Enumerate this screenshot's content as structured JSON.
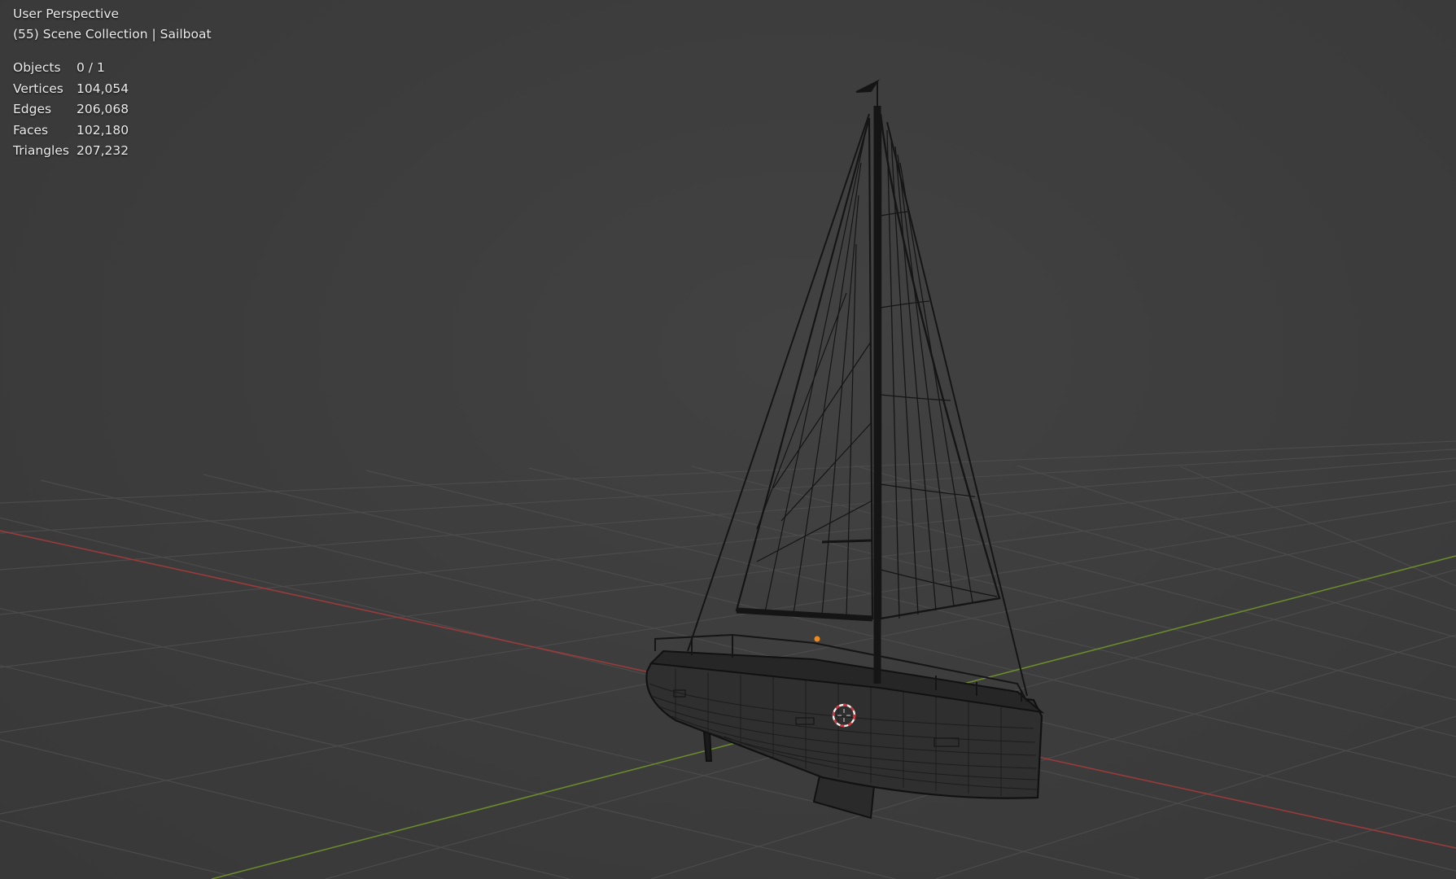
{
  "viewport": {
    "mode_label": "User Perspective",
    "collection_label": "(55) Scene Collection | Sailboat",
    "stats": [
      {
        "label": "Objects",
        "value": "0 / 1"
      },
      {
        "label": "Vertices",
        "value": "104,054"
      },
      {
        "label": "Edges",
        "value": "206,068"
      },
      {
        "label": "Faces",
        "value": "102,180"
      },
      {
        "label": "Triangles",
        "value": "207,232"
      }
    ]
  },
  "colors": {
    "background": "#3d3d3d",
    "grid": "#4a4a4a",
    "x_axis": "#9a3b3b",
    "y_axis": "#6a8a2c",
    "wireframe": "#111111",
    "origin_dot": "#f08a1c",
    "cursor_red": "#d8333a",
    "cursor_white": "#f2f2f2"
  }
}
